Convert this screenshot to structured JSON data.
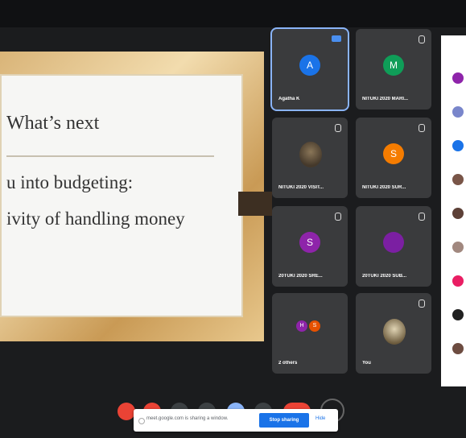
{
  "slide": {
    "title": "What’s next",
    "line1": "u into budgeting:",
    "line2": "ivity of handling money"
  },
  "tiles": [
    {
      "initial": "A",
      "name": "Agatha K",
      "color": "#1a73e8"
    },
    {
      "initial": "M",
      "name": "NITUKI 2020 MARI...",
      "color": "#0f9d58"
    },
    {
      "initial": "",
      "name": "NITUKI 2020 VISIT...",
      "color": ""
    },
    {
      "initial": "S",
      "name": "NITUKI 2020 SUR...",
      "color": "#f57c00"
    },
    {
      "initial": "S",
      "name": "20TUKI 2020 SRE...",
      "color": "#8e24aa"
    },
    {
      "initial": "",
      "name": "20TUKI 2020 SUB...",
      "color": "#7b1fa2"
    },
    {
      "initial": "",
      "name": "2 others",
      "color": ""
    },
    {
      "initial": "",
      "name": "You",
      "color": ""
    }
  ],
  "mini_avatars": [
    {
      "initial": "H",
      "color": "#8e24aa"
    },
    {
      "initial": "S",
      "color": "#e65100"
    }
  ],
  "share_bar": {
    "message": "meet.google.com is sharing a window.",
    "stop_label": "Stop sharing",
    "hide_label": "Hide"
  }
}
